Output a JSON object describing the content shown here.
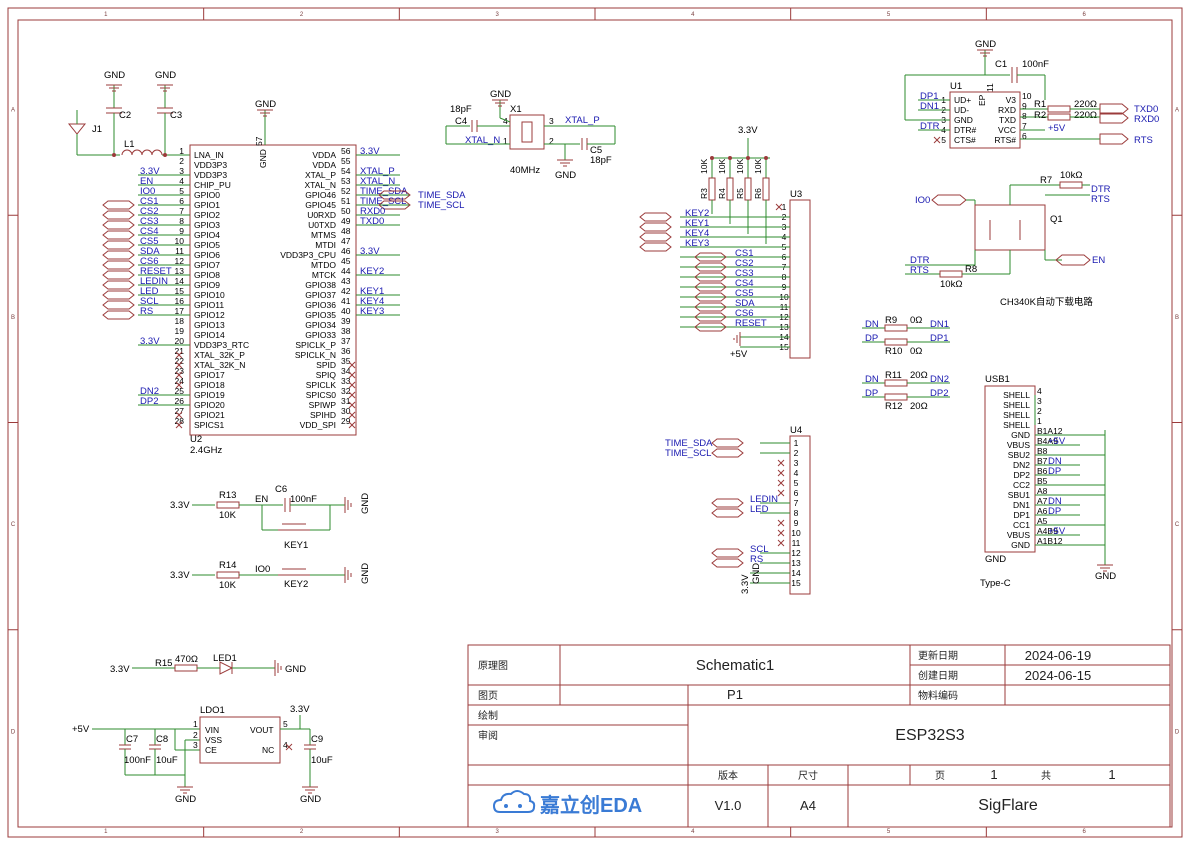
{
  "frame": {
    "cols": [
      "1",
      "2",
      "3",
      "4",
      "5",
      "6"
    ],
    "rows": [
      "A",
      "B",
      "C",
      "D"
    ]
  },
  "title_block": {
    "schematic_label": "原理图",
    "schematic_value": "Schematic1",
    "page_label": "图页",
    "page_value": "P1",
    "drawn_label": "绘制",
    "review_label": "审阅",
    "update_date_label": "更新日期",
    "update_date": "2024-06-19",
    "create_date_label": "创建日期",
    "create_date": "2024-06-15",
    "material_label": "物料编码",
    "material_value": "",
    "project": "ESP32S3",
    "version_label": "版本",
    "version": "V1.0",
    "size_label": "尺寸",
    "size": "A4",
    "page_num_label": "页",
    "page_num": "1",
    "page_total_label": "共",
    "page_total": "1",
    "author": "SigFlare",
    "logo_text": "嘉立创EDA"
  },
  "u2": {
    "ref": "U2",
    "value": "2.4GHz",
    "top_pin_num": "57",
    "top_pin_name": "GND",
    "left_pins": [
      [
        "1",
        "LNA_IN"
      ],
      [
        "2",
        "VDD3P3"
      ],
      [
        "3",
        "VDD3P3"
      ],
      [
        "4",
        "CHIP_PU"
      ],
      [
        "5",
        "GPIO0"
      ],
      [
        "6",
        "GPIO1"
      ],
      [
        "7",
        "GPIO2"
      ],
      [
        "8",
        "GPIO3"
      ],
      [
        "9",
        "GPIO4"
      ],
      [
        "10",
        "GPIO5"
      ],
      [
        "11",
        "GPIO6"
      ],
      [
        "12",
        "GPIO7"
      ],
      [
        "13",
        "GPIO8"
      ],
      [
        "14",
        "GPIO9"
      ],
      [
        "15",
        "GPIO10"
      ],
      [
        "16",
        "GPIO11"
      ],
      [
        "17",
        "GPIO12"
      ],
      [
        "18",
        "GPIO13"
      ],
      [
        "19",
        "GPIO14"
      ],
      [
        "20",
        "VDD3P3_RTC"
      ],
      [
        "21",
        "XTAL_32K_P"
      ],
      [
        "22",
        "XTAL_32K_N"
      ],
      [
        "23",
        "GPIO17"
      ],
      [
        "24",
        "GPIO18"
      ],
      [
        "25",
        "GPIO19"
      ],
      [
        "26",
        "GPIO20"
      ],
      [
        "27",
        "GPIO21"
      ],
      [
        "28",
        "SPICS1"
      ]
    ],
    "right_pins": [
      [
        "56",
        "VDDA"
      ],
      [
        "55",
        "VDDA"
      ],
      [
        "54",
        "XTAL_P"
      ],
      [
        "53",
        "XTAL_N"
      ],
      [
        "52",
        "GPIO46"
      ],
      [
        "51",
        "GPIO45"
      ],
      [
        "50",
        "U0RXD"
      ],
      [
        "49",
        "U0TXD"
      ],
      [
        "48",
        "MTMS"
      ],
      [
        "47",
        "MTDI"
      ],
      [
        "46",
        "VDD3P3_CPU"
      ],
      [
        "45",
        "MTDO"
      ],
      [
        "44",
        "MTCK"
      ],
      [
        "43",
        "GPIO38"
      ],
      [
        "42",
        "GPIO37"
      ],
      [
        "41",
        "GPIO36"
      ],
      [
        "40",
        "GPIO35"
      ],
      [
        "39",
        "GPIO34"
      ],
      [
        "38",
        "GPIO33"
      ],
      [
        "37",
        "SPICLK_P"
      ],
      [
        "36",
        "SPICLK_N"
      ],
      [
        "35",
        "SPID"
      ],
      [
        "34",
        "SPIQ"
      ],
      [
        "33",
        "SPICLK"
      ],
      [
        "32",
        "SPICS0"
      ],
      [
        "31",
        "SPIWP"
      ],
      [
        "30",
        "SPIHD"
      ],
      [
        "29",
        "VDD_SPI"
      ]
    ],
    "left_nets": [
      "",
      "",
      "3.3V",
      "EN",
      "IO0",
      "CS1",
      "CS2",
      "CS3",
      "CS4",
      "CS5",
      "SDA",
      "CS6",
      "RESET",
      "LEDIN",
      "LED",
      "SCL",
      "RS",
      "",
      "",
      "3.3V",
      "",
      "",
      "",
      "",
      "DN2",
      "DP2",
      "",
      ""
    ],
    "right_nets": [
      "3.3V",
      "",
      "XTAL_P",
      "XTAL_N",
      "TIME_SDA",
      "TIME_SCL",
      "RXD0",
      "TXD0",
      "",
      "",
      "3.3V",
      "",
      "KEY2",
      "",
      "KEY1",
      "KEY4",
      "KEY3",
      "",
      "",
      "",
      "",
      "",
      "",
      "",
      "",
      "",
      "",
      ""
    ]
  },
  "antenna": {
    "j1": "J1",
    "c2": "C2",
    "c3": "C3",
    "l1": "L1",
    "gnd": "GND"
  },
  "crystal": {
    "x1": "X1",
    "c4": "C4",
    "c4_val": "18pF",
    "c5": "C5",
    "c5_val": "18pF",
    "freq": "40MHz",
    "xtal_p": "XTAL_P",
    "xtal_n": "XTAL_N",
    "gnd": "GND",
    "pins": [
      "4",
      "3",
      "1",
      "2"
    ]
  },
  "u3": {
    "ref": "U3",
    "supply": "3.3V",
    "resistors": [
      [
        "R3",
        "10K"
      ],
      [
        "R4",
        "10K"
      ],
      [
        "R5",
        "10K"
      ],
      [
        "R6",
        "10K"
      ]
    ],
    "nets": [
      "",
      "KEY2",
      "KEY1",
      "KEY4",
      "KEY3",
      "CS1",
      "CS2",
      "CS3",
      "CS4",
      "CS5",
      "SDA",
      "CS6",
      "RESET",
      "",
      ""
    ],
    "pins": [
      "1",
      "2",
      "3",
      "4",
      "5",
      "6",
      "7",
      "8",
      "9",
      "10",
      "11",
      "12",
      "13",
      "14",
      "15"
    ],
    "gnd_label": "+5V"
  },
  "u4": {
    "ref": "U4",
    "nets": [
      "TIME_SDA",
      "TIME_SCL",
      "",
      "",
      "",
      "",
      "LEDIN",
      "LED",
      "",
      "",
      "",
      "SCL",
      "RS",
      "",
      ""
    ],
    "pins": [
      "1",
      "2",
      "3",
      "4",
      "5",
      "6",
      "7",
      "8",
      "9",
      "10",
      "11",
      "12",
      "13",
      "14",
      "15"
    ],
    "bottom_labels": [
      "3.3V",
      "GND"
    ]
  },
  "ch340": {
    "u1": "U1",
    "c1": "C1",
    "c1_val": "100nF",
    "gnd": "GND",
    "left_pins": [
      [
        "1",
        "UD+"
      ],
      [
        "2",
        "UD-"
      ],
      [
        "3",
        "GND"
      ],
      [
        "4",
        "DTR#"
      ],
      [
        "5",
        "CTS#"
      ]
    ],
    "right_pins": [
      [
        "10",
        "V3"
      ],
      [
        "9",
        "RXD"
      ],
      [
        "8",
        "TXD"
      ],
      [
        "7",
        "VCC"
      ],
      [
        "6",
        "RTS#"
      ]
    ],
    "ep": "EP",
    "ep_num": "11",
    "left_nets": [
      "DP1",
      "DN1",
      "",
      "DTR",
      ""
    ],
    "r1": "R1",
    "r1_val": "220Ω",
    "r2": "R2",
    "r2_val": "220Ω",
    "txd0": "TXD0",
    "rxd0": "RXD0",
    "vcc": "+5V",
    "rts": "RTS",
    "q1": "Q1",
    "r7": "R7",
    "r7_val": "10kΩ",
    "r8": "R8",
    "r8_val": "10kΩ",
    "io0": "IO0",
    "dtr": "DTR",
    "rts2": "RTS",
    "en": "EN",
    "caption": "CH340K自动下载电路"
  },
  "usb_res": [
    [
      "R9",
      "0Ω",
      "DN",
      "DN1"
    ],
    [
      "R10",
      "0Ω",
      "DP",
      "DP1"
    ],
    [
      "R11",
      "20Ω",
      "DN",
      "DN2"
    ],
    [
      "R12",
      "20Ω",
      "DP",
      "DP2"
    ]
  ],
  "usb": {
    "ref": "USB1",
    "pins": [
      [
        "4",
        "SHELL"
      ],
      [
        "3",
        "SHELL"
      ],
      [
        "2",
        "SHELL"
      ],
      [
        "1",
        "SHELL"
      ],
      [
        "B1A12",
        "GND"
      ],
      [
        "B4A9",
        "VBUS"
      ],
      [
        "B8",
        "SBU2"
      ],
      [
        "B7",
        "DN2"
      ],
      [
        "B6",
        "DP2"
      ],
      [
        "B5",
        "CC2"
      ],
      [
        "A8",
        "SBU1"
      ],
      [
        "A7",
        "DN1"
      ],
      [
        "A6",
        "DP1"
      ],
      [
        "A5",
        "CC1"
      ],
      [
        "A4B9",
        "VBUS"
      ],
      [
        "A1B12",
        "GND"
      ]
    ],
    "nets": [
      "",
      "",
      "",
      "",
      "",
      "+5V",
      "",
      "DN",
      "DP",
      "",
      "",
      "DN",
      "DP",
      "",
      "+5V",
      ""
    ],
    "gnd": "GND",
    "bottom_label": "GND",
    "caption": "Type-C"
  },
  "keys": {
    "r13": "R13",
    "r13_val": "10K",
    "en": "EN",
    "c6": "C6",
    "c6_val": "100nF",
    "key1": "KEY1",
    "r14": "R14",
    "r14_val": "10K",
    "io0": "IO0",
    "key2": "KEY2",
    "supply": "3.3V",
    "gnd": "GND"
  },
  "led": {
    "supply": "3.3V",
    "r15": "R15",
    "r15_val": "470Ω",
    "led1": "LED1",
    "gnd": "GND"
  },
  "ldo": {
    "ref": "LDO1",
    "vin": "VIN",
    "vss": "VSS",
    "ce": "CE",
    "vout": "VOUT",
    "nc": "NC",
    "pin1": "1",
    "pin2": "2",
    "pin3": "3",
    "pin4": "4",
    "pin5": "5",
    "in": "+5V",
    "out": "3.3V",
    "c7": "C7",
    "c7_val": "100nF",
    "c8": "C8",
    "c8_val": "10uF",
    "c9": "C9",
    "c9_val": "10uF",
    "gnd": "GND"
  }
}
